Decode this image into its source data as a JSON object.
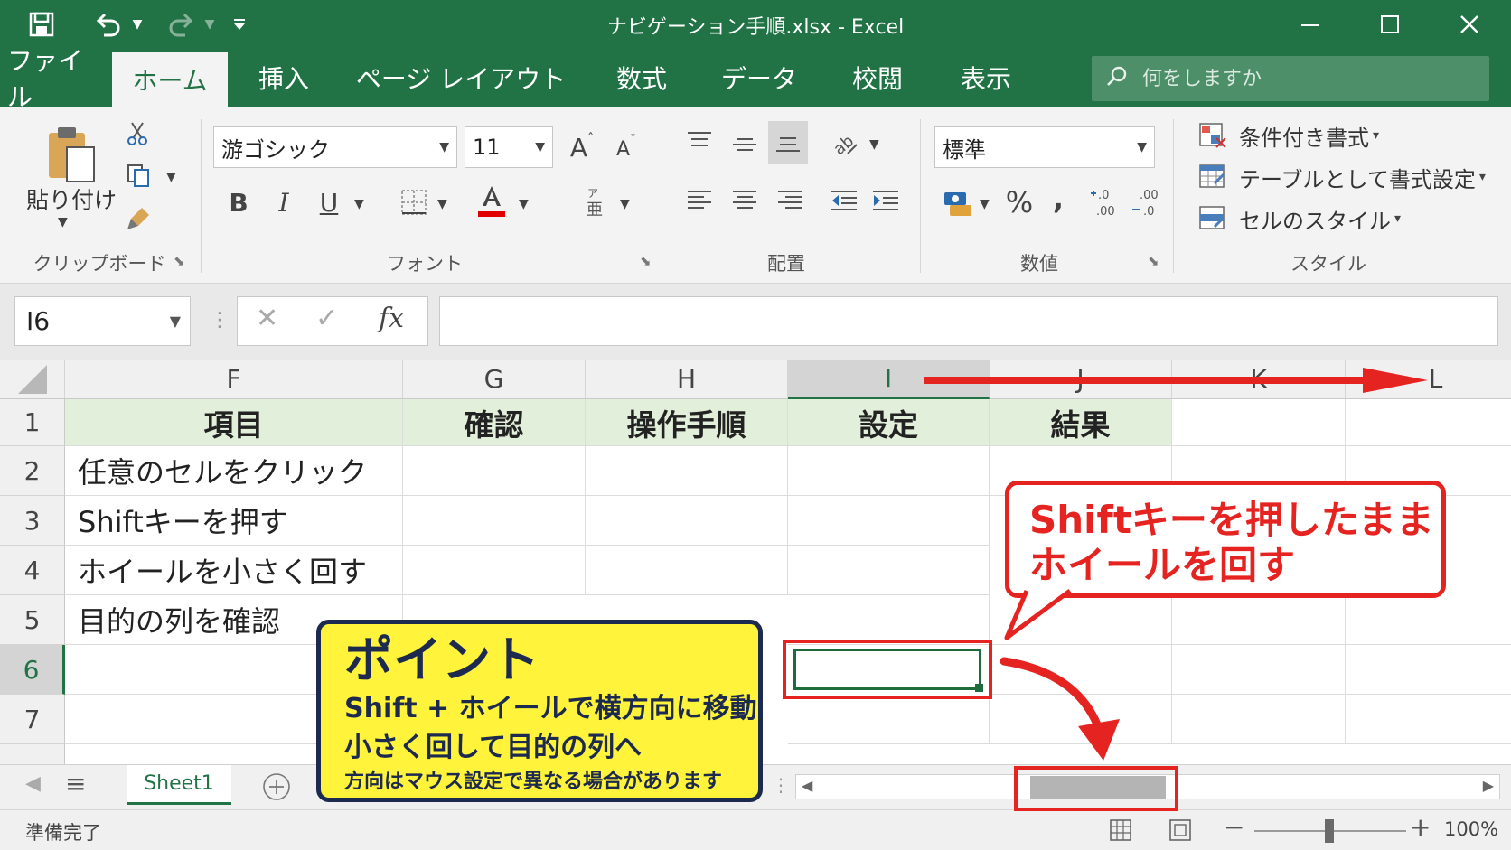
{
  "window": {
    "title": "ナビゲーション手順.xlsx  -  Excel",
    "theme_color": "#217346"
  },
  "quick_access": {
    "save_icon": "save-icon",
    "undo_icon": "undo-icon",
    "redo_icon": "redo-icon",
    "customize_icon": "customize-icon"
  },
  "tabs": [
    {
      "label": "ファイル",
      "active": false
    },
    {
      "label": "ホーム",
      "active": true
    },
    {
      "label": "挿入",
      "active": false
    },
    {
      "label": "ページ レイアウト",
      "active": false
    },
    {
      "label": "数式",
      "active": false
    },
    {
      "label": "データ",
      "active": false
    },
    {
      "label": "校閲",
      "active": false
    },
    {
      "label": "表示",
      "active": false
    }
  ],
  "tell_me": {
    "placeholder": "何をしますか"
  },
  "ribbon": {
    "clipboard": {
      "label": "クリップボード",
      "paste_label": "貼り付け"
    },
    "font": {
      "label": "フォント",
      "font_name": "游ゴシック",
      "font_size": "11",
      "bold": "B",
      "italic": "I",
      "underline": "U",
      "grow": "A",
      "shrink": "A",
      "font_color": "#e00000"
    },
    "alignment": {
      "label": "配置"
    },
    "number": {
      "label": "数値",
      "format": "標準",
      "percent": "%",
      "comma": ","
    },
    "styles": {
      "label": "スタイル",
      "items": [
        "条件付き書式",
        "テーブルとして書式設定",
        "セルのスタイル"
      ]
    }
  },
  "formula_bar": {
    "name_box": "I6",
    "cancel": "✕",
    "enter": "✓",
    "fx": "fx",
    "formula": ""
  },
  "grid": {
    "columns": [
      "F",
      "G",
      "H",
      "I",
      "J",
      "K",
      "L"
    ],
    "selected_column": "I",
    "rows": [
      "1",
      "2",
      "3",
      "4",
      "5",
      "6",
      "7"
    ],
    "selected_row": "6",
    "header_row": [
      "項目",
      "確認",
      "操作手順",
      "設定",
      "結果"
    ],
    "header_fill": "#e2efda",
    "items": [
      "任意のセルをクリック",
      "Shiftキーを押す",
      "ホイールを小さく回す",
      "目的の列を確認"
    ],
    "selected_cell": "I6"
  },
  "sheets": {
    "tabs": [
      "Sheet1"
    ],
    "active": "Sheet1"
  },
  "status": {
    "text": "準備完了",
    "zoom": "100%"
  },
  "annotations": {
    "callout": {
      "line1": "Shiftキーを押したまま",
      "line2": "ホイールを回す",
      "color": "#e52421"
    },
    "point": {
      "title": "ポイント",
      "line1": "Shift + ホイールで横方向に移動",
      "line2": "小さく回して目的の列へ",
      "line3": "方向はマウス設定で異なる場合があります",
      "bg_color": "#fff33b",
      "border_color": "#1d2a4f"
    }
  }
}
